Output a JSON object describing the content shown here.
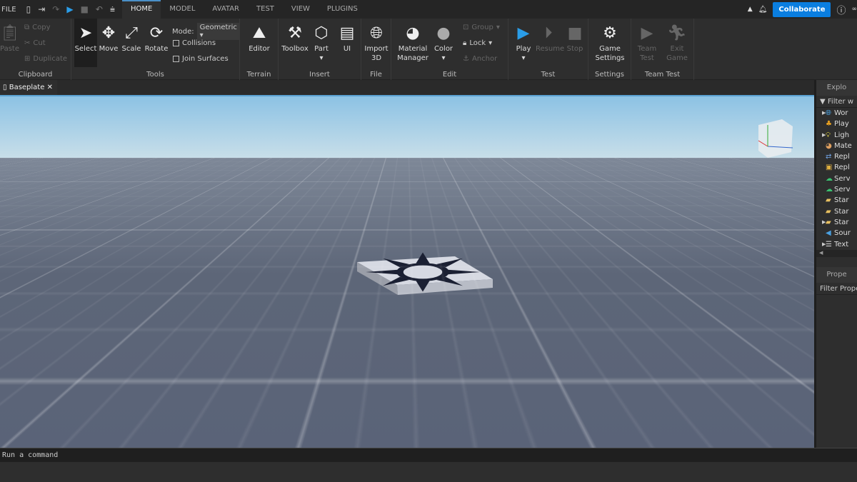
{
  "menu": {
    "file": "FILE",
    "tabs": [
      "HOME",
      "MODEL",
      "AVATAR",
      "TEST",
      "VIEW",
      "PLUGINS"
    ],
    "active_tab": "HOME",
    "collaborate": "Collaborate"
  },
  "ribbon": {
    "clipboard": {
      "label": "Clipboard",
      "paste": "Paste",
      "copy": "Copy",
      "cut": "Cut",
      "duplicate": "Duplicate"
    },
    "tools": {
      "label": "Tools",
      "select": "Select",
      "move": "Move",
      "scale": "Scale",
      "rotate": "Rotate",
      "mode_label": "Mode:",
      "mode_value": "Geometric",
      "collisions": "Collisions",
      "join_surfaces": "Join Surfaces"
    },
    "terrain": {
      "label": "Terrain",
      "editor": "Editor"
    },
    "insert": {
      "label": "Insert",
      "toolbox": "Toolbox",
      "part": "Part",
      "ui": "UI"
    },
    "file": {
      "label": "File",
      "import3d": "Import 3D"
    },
    "edit": {
      "label": "Edit",
      "material_manager": "Material Manager",
      "color": "Color",
      "group": "Group",
      "lock": "Lock",
      "anchor": "Anchor"
    },
    "test": {
      "label": "Test",
      "play": "Play",
      "resume": "Resume",
      "stop": "Stop"
    },
    "settings": {
      "label": "Settings",
      "game_settings": "Game Settings"
    },
    "team_test": {
      "label": "Team Test",
      "team_test": "Team Test",
      "exit_game": "Exit Game"
    }
  },
  "document_tab": "Baseplate",
  "explorer": {
    "title": "Explo",
    "filter": "Filter w",
    "items": [
      {
        "label": "Wor",
        "expand": true,
        "icon": "globe"
      },
      {
        "label": "Play",
        "expand": false,
        "icon": "players"
      },
      {
        "label": "Ligh",
        "expand": true,
        "icon": "bulb"
      },
      {
        "label": "Mate",
        "expand": false,
        "icon": "material"
      },
      {
        "label": "Repl",
        "expand": false,
        "icon": "replicated"
      },
      {
        "label": "Repl",
        "expand": false,
        "icon": "storage"
      },
      {
        "label": "Serv",
        "expand": false,
        "icon": "server"
      },
      {
        "label": "Serv",
        "expand": false,
        "icon": "server-storage"
      },
      {
        "label": "Star",
        "expand": false,
        "icon": "folder"
      },
      {
        "label": "Star",
        "expand": false,
        "icon": "folder"
      },
      {
        "label": "Star",
        "expand": true,
        "icon": "folder-player"
      },
      {
        "label": "Sour",
        "expand": false,
        "icon": "sound"
      },
      {
        "label": "Text",
        "expand": true,
        "icon": "chat"
      }
    ]
  },
  "properties": {
    "title": "Prope",
    "filter": "Filter Proper"
  },
  "command_bar": {
    "placeholder": "Run a command"
  },
  "colors": {
    "accent": "#0a7ee0",
    "play": "#2a9de8"
  }
}
